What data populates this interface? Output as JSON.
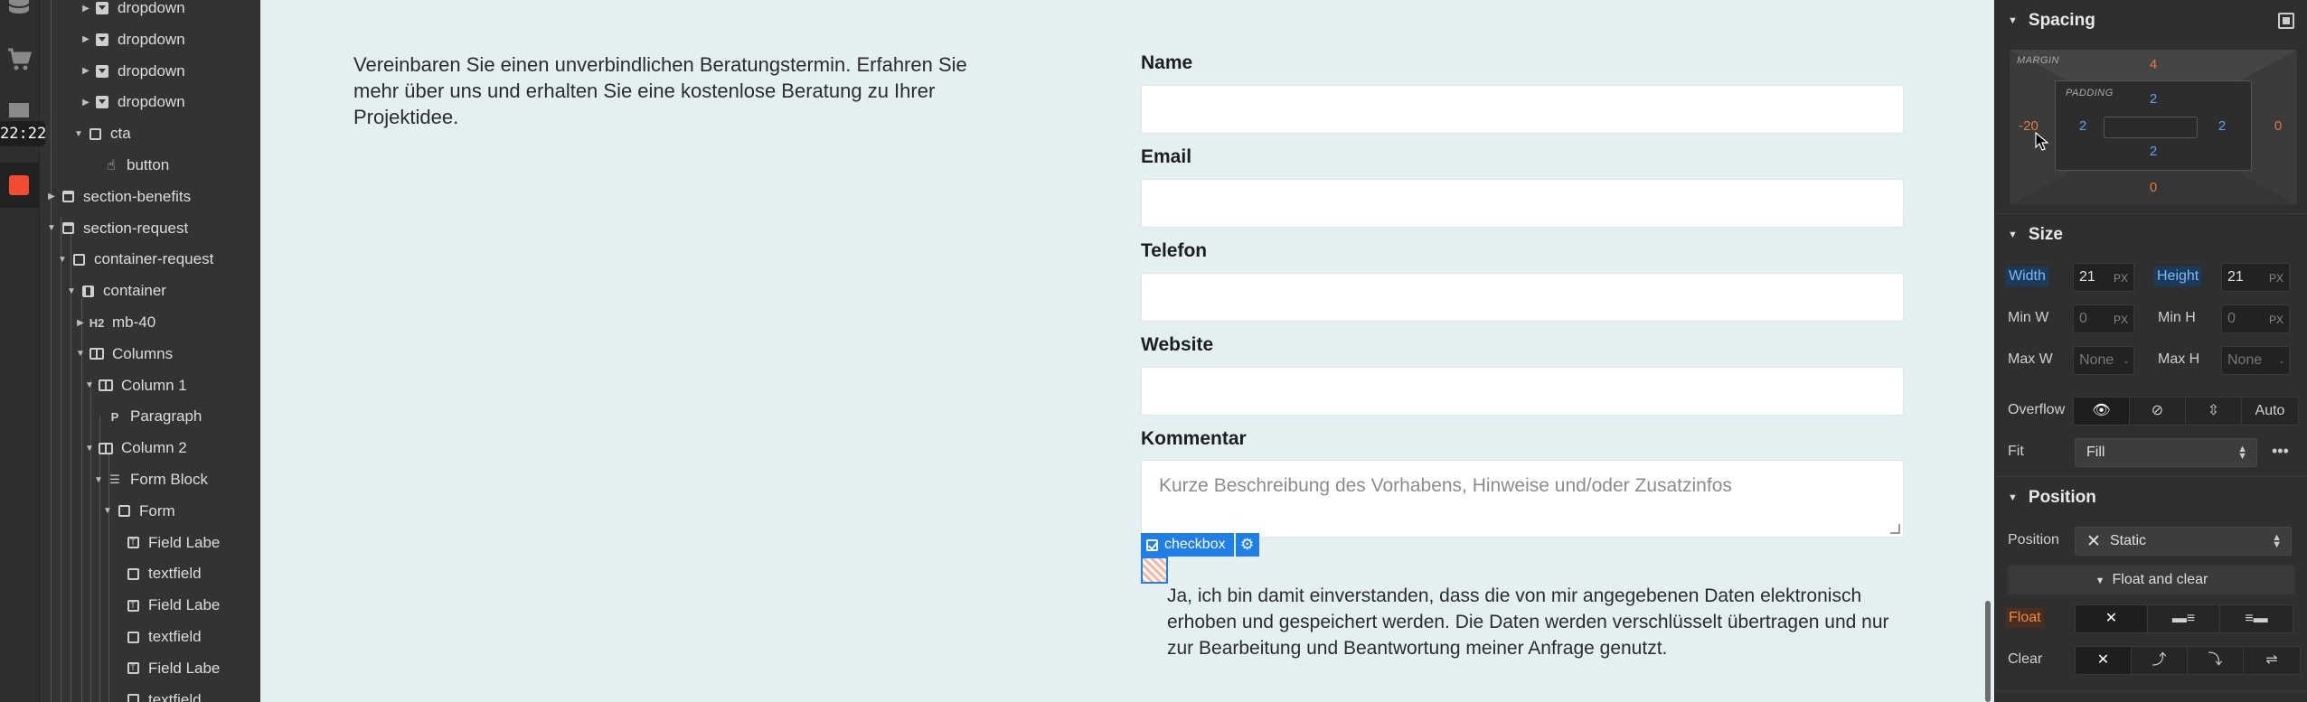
{
  "rail": {
    "timer": "22:22",
    "icons": [
      "database-icon",
      "cart-icon",
      "assets-icon",
      "record-icon"
    ]
  },
  "navigator": {
    "items": [
      {
        "label": "dropdown",
        "icon": "dropdown-icon",
        "expanded": false
      },
      {
        "label": "dropdown",
        "icon": "dropdown-icon",
        "expanded": false
      },
      {
        "label": "dropdown",
        "icon": "dropdown-icon",
        "expanded": false
      },
      {
        "label": "dropdown",
        "icon": "dropdown-icon",
        "expanded": false
      },
      {
        "label": "cta",
        "icon": "div-icon",
        "expanded": true
      },
      {
        "label": "button",
        "icon": "hand-icon",
        "expanded": null
      },
      {
        "label": "section-benefits",
        "icon": "section-icon",
        "expanded": false
      },
      {
        "label": "section-request",
        "icon": "section-icon",
        "expanded": true
      },
      {
        "label": "container-request",
        "icon": "div-icon",
        "expanded": true
      },
      {
        "label": "container",
        "icon": "container-icon",
        "expanded": true
      },
      {
        "label": "mb-40",
        "icon": "heading-icon",
        "icon_text": "H2",
        "expanded": false
      },
      {
        "label": "Columns",
        "icon": "columns-icon",
        "expanded": true
      },
      {
        "label": "Column 1",
        "icon": "column-icon",
        "expanded": true
      },
      {
        "label": "Paragraph",
        "icon": "paragraph-icon",
        "icon_text": "P",
        "expanded": null
      },
      {
        "label": "Column 2",
        "icon": "column-icon",
        "expanded": true
      },
      {
        "label": "Form Block",
        "icon": "form-block-icon",
        "expanded": true
      },
      {
        "label": "Form",
        "icon": "div-icon",
        "expanded": true
      },
      {
        "label": "Field Labe",
        "icon": "label-icon",
        "expanded": null
      },
      {
        "label": "textfield",
        "icon": "div-icon",
        "expanded": null
      },
      {
        "label": "Field Labe",
        "icon": "label-icon",
        "expanded": null
      },
      {
        "label": "textfield",
        "icon": "div-icon",
        "expanded": null
      },
      {
        "label": "Field Labe",
        "icon": "label-icon",
        "expanded": null
      },
      {
        "label": "textfield",
        "icon": "div-icon",
        "expanded": null
      }
    ]
  },
  "canvas": {
    "intro": "Vereinbaren Sie einen unverbindlichen Beratungstermin. Erfahren Sie mehr über uns und erhalten Sie eine kostenlose Beratung zu Ihrer Projektidee.",
    "fields": [
      {
        "label": "Name",
        "value": ""
      },
      {
        "label": "Email",
        "value": ""
      },
      {
        "label": "Telefon",
        "value": ""
      },
      {
        "label": "Website",
        "value": ""
      }
    ],
    "comment": {
      "label": "Kommentar",
      "placeholder": "Kurze Beschreibung des Vorhabens, Hinweise und/oder Zusatzinfos"
    },
    "selected_element_tag": "checkbox",
    "consent": "Ja, ich bin damit einverstanden, dass die von mir angegebenen Daten elektronisch erhoben und gespeichert werden. Die Daten werden verschlüsselt übertragen und nur zur Bearbeitung und Beantwortung meiner Anfrage genutzt."
  },
  "style_panel": {
    "spacing": {
      "title": "Spacing",
      "margin_label": "MARGIN",
      "padding_label": "PADDING",
      "margin": {
        "top": "4",
        "right": "0",
        "bottom": "0",
        "left": "-20"
      },
      "padding": {
        "top": "2",
        "right": "2",
        "bottom": "2",
        "left": "2"
      }
    },
    "size": {
      "title": "Size",
      "width_label": "Width",
      "width": "21",
      "width_unit": "PX",
      "height_label": "Height",
      "height": "21",
      "height_unit": "PX",
      "min_w_label": "Min W",
      "min_w": "0",
      "min_w_unit": "PX",
      "min_h_label": "Min H",
      "min_h": "0",
      "min_h_unit": "PX",
      "max_w_label": "Max W",
      "max_w": "None",
      "max_w_unit": "-",
      "max_h_label": "Max H",
      "max_h": "None",
      "max_h_unit": "-",
      "overflow_label": "Overflow",
      "overflow_auto": "Auto",
      "fit_label": "Fit",
      "fit_value": "Fill"
    },
    "position": {
      "title": "Position",
      "position_label": "Position",
      "position_value": "Static",
      "float_clear_label": "Float and clear",
      "float_label": "Float",
      "clear_label": "Clear"
    },
    "colors": {
      "accent": "#1f7ee8",
      "margin_value": "#e8783c",
      "padding_value": "#5aa0f0"
    }
  }
}
